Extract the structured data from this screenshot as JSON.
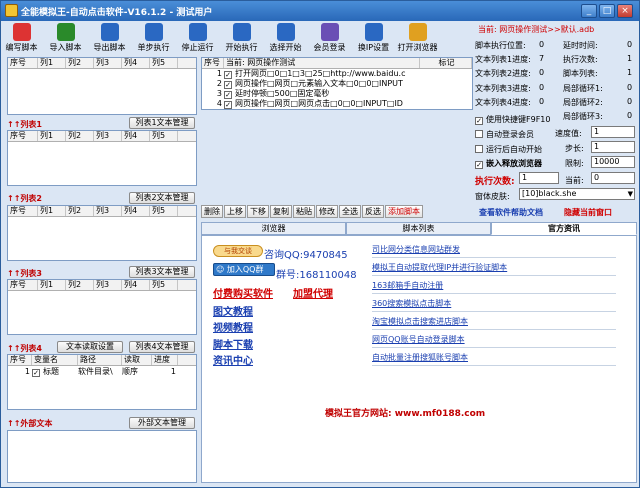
{
  "window": {
    "title": "全能模拟王-自动点击软件-V16.1.2 - 测试用户"
  },
  "colors": {
    "title": "#2968b8",
    "accent_red": "#c00000",
    "link_blue": "#1a3fb0"
  },
  "toolbar": [
    {
      "label": "编写脚本",
      "icon": "edit-icon",
      "color": "#d33"
    },
    {
      "label": "导入脚本",
      "icon": "import-arrow-icon",
      "color": "#2a8a2a"
    },
    {
      "label": "导出脚本",
      "icon": "export-arrow-icon",
      "color": "#2a68c2"
    },
    {
      "label": "单步执行",
      "icon": "step-icon",
      "color": "#2a68c2"
    },
    {
      "label": "停止运行",
      "icon": "stop-icon",
      "color": "#2a68c2"
    },
    {
      "label": "开始执行",
      "icon": "play-icon",
      "color": "#2a68c2"
    },
    {
      "label": "选择开始",
      "icon": "fast-forward-icon",
      "color": "#2a68c2"
    },
    {
      "label": "会员登录",
      "icon": "user-icon",
      "color": "#6a4fb5"
    },
    {
      "label": "换IP设置",
      "icon": "network-icon",
      "color": "#2a68c2"
    },
    {
      "label": "打开浏览器",
      "icon": "browser-icon",
      "color": "#e0a020"
    }
  ],
  "current_script": "当前: 网页操作测试>>默认.adb",
  "col_headers": [
    "序号",
    "列1",
    "列2",
    "列3",
    "列4",
    "列5"
  ],
  "sections": {
    "list1": {
      "title": "↑↑列表1",
      "button": "列表1文本管理"
    },
    "list2": {
      "title": "↑↑列表2",
      "button": "列表2文本管理"
    },
    "list3": {
      "title": "↑↑列表3",
      "button": "列表3文本管理"
    },
    "list4": {
      "title": "↑↑列表4",
      "button_read": "文本读取设置",
      "button": "列表4文本管理"
    },
    "ext": {
      "title": "↑↑外部文本",
      "button": "外部文本管理"
    }
  },
  "list4": {
    "headers": [
      "序号",
      "变量名",
      "路径",
      "读取",
      "进度"
    ],
    "row": [
      "1",
      "标题",
      "软件目录\\",
      "顺序",
      "1"
    ]
  },
  "script_grid": {
    "headers": [
      "序号",
      "当前: 网页操作测试",
      "标记"
    ],
    "rows": [
      {
        "n": "1",
        "text": "打开网页□0□1□3□25□http://www.baidu.c"
      },
      {
        "n": "2",
        "text": "网页操作□网页□元素输入文本□0□0□INPUT"
      },
      {
        "n": "3",
        "text": "延时停顿□500□固定毫秒"
      },
      {
        "n": "4",
        "text": "网页操作□网页□网页点击□0□0□INPUT□ID"
      }
    ]
  },
  "stats": {
    "rows": [
      {
        "l1": "脚本执行位置:",
        "v1": "0",
        "l2": "延时时间:",
        "v2": "0"
      },
      {
        "l1": "文本列表1进度:",
        "v1": "7",
        "l2": "执行次数:",
        "v2": "1"
      },
      {
        "l1": "文本列表2进度:",
        "v1": "0",
        "l2": "脚本列表:",
        "v2": "1"
      },
      {
        "l1": "文本列表3进度:",
        "v1": "0",
        "l2": "局部循环1:",
        "v2": "0"
      },
      {
        "l1": "文本列表4进度:",
        "v1": "0",
        "l2": "局部循环2:",
        "v2": "0"
      },
      {
        "l1": "",
        "v1": "",
        "l2": "局部循环3:",
        "v2": "0"
      }
    ]
  },
  "options": {
    "hotkey": "使用快捷键F9F10",
    "auto_login": "自动登录会员",
    "auto_start": "运行后自动开始",
    "embed_browser": "嵌入释放浏览器",
    "speed_label": "速度值:",
    "speed_value": "1",
    "step_label": "步长:",
    "step_value": "1",
    "limit_label": "限制:",
    "limit_value": "10000",
    "exec_label": "执行次数:",
    "exec_value": "1",
    "current_label": "当前:",
    "current_value": "0",
    "skin_label": "窗体皮肤:",
    "skin_value": "[10]black.she"
  },
  "ops": [
    "删除",
    "上移",
    "下移",
    "复制",
    "粘贴",
    "修改",
    "全选",
    "反选",
    "添加脚本"
  ],
  "help_link": "查看软件帮助文档",
  "hide_link": "隐藏当前窗口",
  "tabs": [
    "浏览器",
    "脚本列表",
    "官方资讯"
  ],
  "official": {
    "qq_badge": "与我交谈",
    "qq_group_badge": "加入QQ群",
    "qq_text": "咨询QQ:9470845",
    "group_text": "群号:168110048",
    "buy_link": "付费购买软件",
    "agent_link": "加盟代理",
    "links_left": [
      "图文教程",
      "视频教程",
      "脚本下载",
      "资讯中心"
    ],
    "links_right": [
      "司比网分类信息网站群发",
      "模拟王自动提取代理IP并进行验证脚本",
      "163邮箱手自动注册",
      "360搜索模拟点击脚本",
      "淘宝模拟点击搜索进店脚本",
      "网页QQ账号自动登录脚本",
      "自动批量注册搜狐账号脚本"
    ],
    "site": "模拟王官方网站: www.mf0188.com"
  }
}
